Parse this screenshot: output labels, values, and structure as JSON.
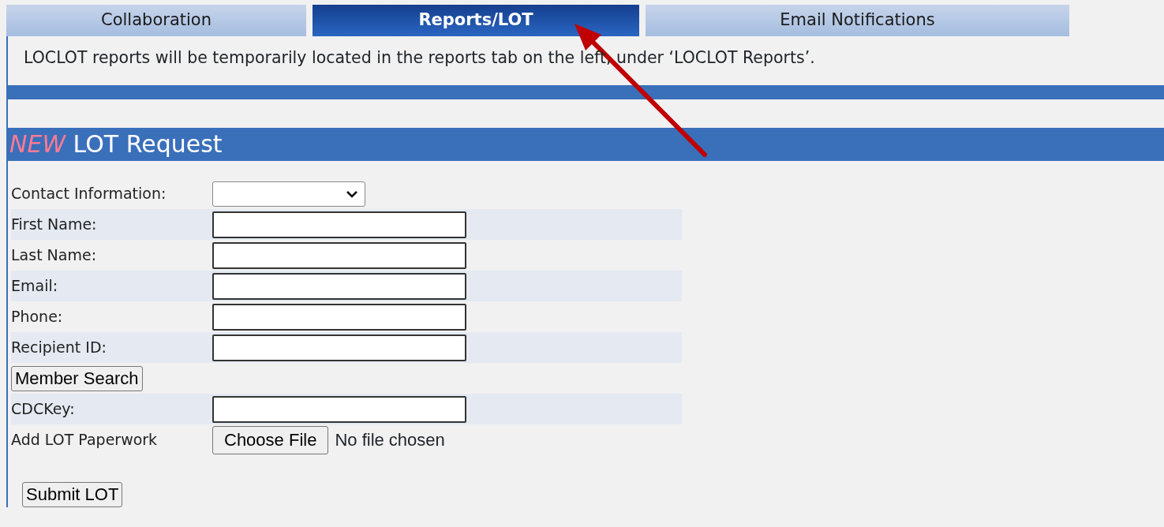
{
  "tabs": [
    {
      "label": "Collaboration",
      "selected": false
    },
    {
      "label": "Reports/LOT",
      "selected": true
    },
    {
      "label": "Email Notifications",
      "selected": false
    }
  ],
  "notice": "LOCLOT reports will be temporarily located in the reports tab on the left, under ‘LOCLOT Reports’.",
  "header": {
    "emphasis": "NEW",
    "title": "LOT Request"
  },
  "form_rows": [
    {
      "kind": "select",
      "label": "Contact Information:"
    },
    {
      "kind": "text",
      "label": "First Name:"
    },
    {
      "kind": "text",
      "label": "Last Name:"
    },
    {
      "kind": "text",
      "label": "Email:"
    },
    {
      "kind": "text",
      "label": "Phone:"
    },
    {
      "kind": "text",
      "label": "Recipient ID:"
    },
    {
      "kind": "button",
      "label": "Member Search"
    },
    {
      "kind": "text",
      "label": "CDCKey:"
    },
    {
      "kind": "file",
      "label": "Add LOT Paperwork",
      "button": "Choose File",
      "status": "No file chosen"
    }
  ],
  "submit": "Submit LOT"
}
